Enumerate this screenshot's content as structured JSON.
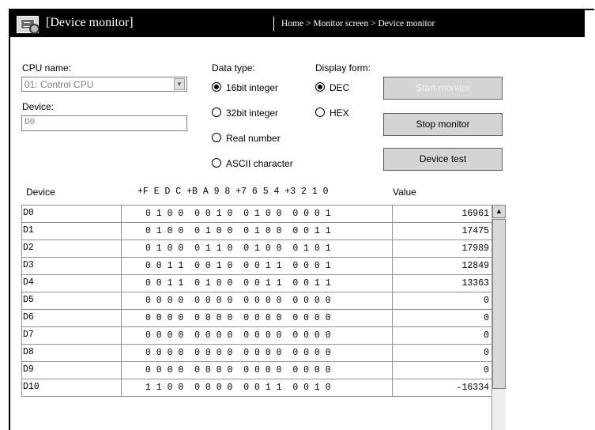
{
  "window": {
    "title": "[Device monitor]",
    "breadcrumb": "Home > Monitor screen > Device monitor",
    "icon": "monitor-screen-icon"
  },
  "form": {
    "cpu_label": "CPU name:",
    "cpu_value": "01: Control CPU",
    "device_label": "Device:",
    "device_value": "D0",
    "data_type_label": "Data type:",
    "data_types": [
      {
        "label": "16bit integer",
        "selected": true
      },
      {
        "label": "32bit integer",
        "selected": false
      },
      {
        "label": "Real number",
        "selected": false
      },
      {
        "label": "ASCII character",
        "selected": false
      }
    ],
    "display_form_label": "Display form:",
    "display_forms": [
      {
        "label": "DEC",
        "selected": true
      },
      {
        "label": "HEX",
        "selected": false
      }
    ]
  },
  "buttons": {
    "start_monitor": "Start monitor",
    "start_monitor_enabled": false,
    "stop_monitor": "Stop monitor",
    "device_test": "Device test"
  },
  "table": {
    "headers": {
      "device": "Device",
      "bits": "+F E D C +B A 9 8 +7 6 5 4 +3 2 1 0",
      "value": "Value"
    },
    "rows": [
      {
        "device": "D0",
        "bits": "0 1 0 0  0 0 1 0  0 1 0 0  0 0 0 1",
        "value": "16961"
      },
      {
        "device": "D1",
        "bits": "0 1 0 0  0 1 0 0  0 1 0 0  0 0 1 1",
        "value": "17475"
      },
      {
        "device": "D2",
        "bits": "0 1 0 0  0 1 1 0  0 1 0 0  0 1 0 1",
        "value": "17989"
      },
      {
        "device": "D3",
        "bits": "0 0 1 1  0 0 1 0  0 0 1 1  0 0 0 1",
        "value": "12849"
      },
      {
        "device": "D4",
        "bits": "0 0 1 1  0 1 0 0  0 0 1 1  0 0 1 1",
        "value": "13363"
      },
      {
        "device": "D5",
        "bits": "0 0 0 0  0 0 0 0  0 0 0 0  0 0 0 0",
        "value": "0"
      },
      {
        "device": "D6",
        "bits": "0 0 0 0  0 0 0 0  0 0 0 0  0 0 0 0",
        "value": "0"
      },
      {
        "device": "D7",
        "bits": "0 0 0 0  0 0 0 0  0 0 0 0  0 0 0 0",
        "value": "0"
      },
      {
        "device": "D8",
        "bits": "0 0 0 0  0 0 0 0  0 0 0 0  0 0 0 0",
        "value": "0"
      },
      {
        "device": "D9",
        "bits": "0 0 0 0  0 0 0 0  0 0 0 0  0 0 0 0",
        "value": "0"
      },
      {
        "device": "D10",
        "bits": "1 1 0 0  0 0 0 0  0 0 1 1  0 0 1 0",
        "value": "-16334"
      }
    ]
  }
}
